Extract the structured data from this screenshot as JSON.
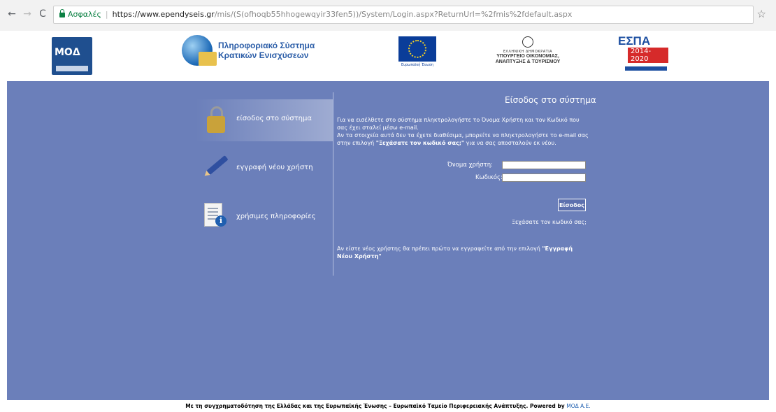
{
  "browser": {
    "back_icon": "←",
    "forward_icon": "→",
    "reload_icon": "C",
    "secure_label": "Ασφαλές",
    "separator": "|",
    "url_host": "https://www.ependyseis.gr",
    "url_path": "/mis/(S(ofhoqb55hhogewqyir33fen5))/System/Login.aspx?ReturnUrl=%2fmis%2fdefault.aspx",
    "star_icon": "☆"
  },
  "header": {
    "moda_logo_text": "ΜΟΔ",
    "pske_line1": "Πληροφοριακό Σύστημα",
    "pske_line2": "Κρατικών Ενισχύσεων",
    "eu_caption": "Ευρωπαϊκή Ένωση",
    "ministry_small": "ΕΛΛΗΝΙΚΗ ΔΗΜΟΚΡΑΤΙΑ",
    "ministry_line1": "ΥΠΟΥΡΓΕΙΟ ΟΙΚΟΝΟΜΙΑΣ,",
    "ministry_line2": "ΑΝΑΠΤΥΞΗΣ & ΤΟΥΡΙΣΜΟΥ",
    "espa_title": "ΕΣΠΑ",
    "espa_years": "2014-2020"
  },
  "nav": {
    "items": [
      {
        "label": "είσοδος στο σύστημα",
        "icon": "padlock-icon"
      },
      {
        "label": "εγγραφή νέου χρήστη",
        "icon": "pencil-icon"
      },
      {
        "label": "χρήσιμες πληροφορίες",
        "icon": "info-document-icon"
      }
    ]
  },
  "login": {
    "title": "Είσοδος στο σύστημα",
    "desc_part1": "Για να εισέλθετε στο σύστημα πληκτρολογήστε το Όνομα Χρήστη και τον Κωδικό που σας έχει σταλεί μέσω e-mail.",
    "desc_part2": "Αν τα στοιχεία αυτά δεν τα έχετε διαθέσιμα, μπορείτε να πληκτρολογήστε το e-mail σας στην επιλογή",
    "desc_link": "\"Ξεχάσατε τον κωδικό σας;\"",
    "desc_part3": "για να σας αποσταλούν εκ νέου.",
    "username_label": "Όνομα χρήστη:",
    "username_value": "",
    "password_label": "Κωδικός:",
    "password_value": "",
    "submit_label": "Είσοδος",
    "forgot_label": "Ξεχάσατε τον κωδικό σας;",
    "newuser_text": "Αν είστε νέος χρήστης θα πρέπει πρώτα να εγγραφείτε από την επιλογή",
    "newuser_link": "\"Εγγραφή Νέου Χρήστη\""
  },
  "footer": {
    "text": "Με τη συγχρηματοδότηση της Ελλάδας και της Ευρωπαϊκής Ένωσης – Ευρωπαϊκό Ταμείο Περιφερειακής Ανάπτυξης.  Powered by",
    "powered_by": "ΜΟΔ Α.Ε."
  },
  "colors": {
    "panel_bg": "#6b7fba",
    "secure_green": "#0b8043",
    "link_blue": "#1f5fb0"
  }
}
